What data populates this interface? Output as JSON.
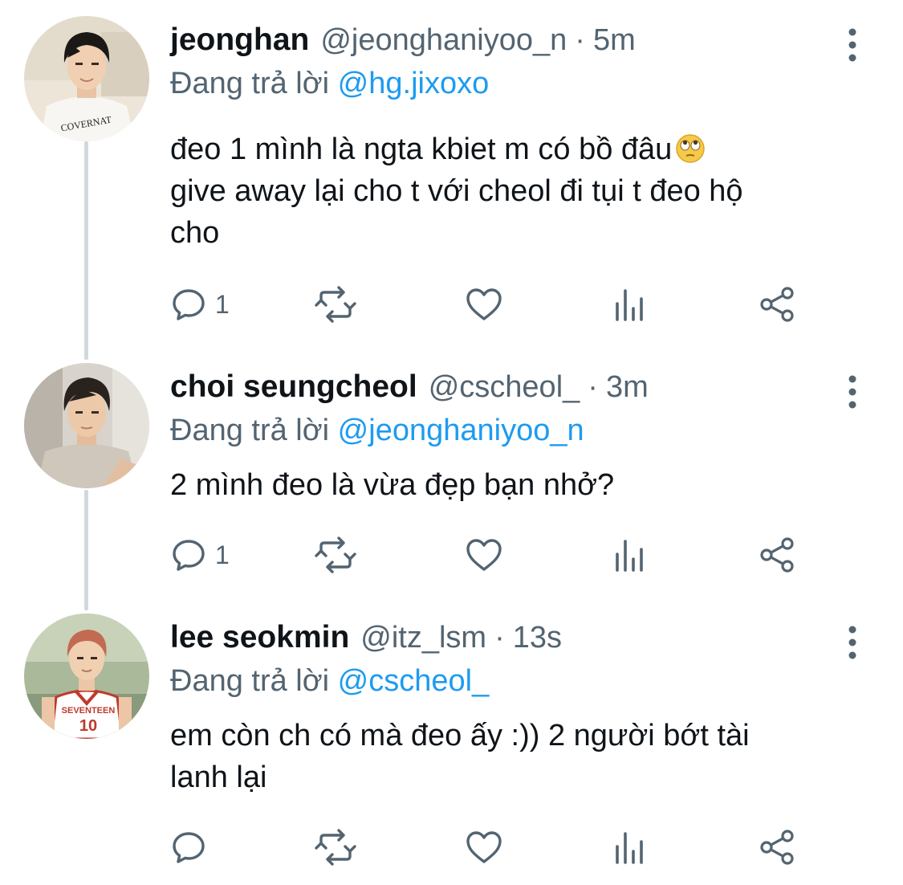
{
  "tweets": [
    {
      "name": "jeonghan",
      "handle": "@jeonghaniyoo_n",
      "separator": "·",
      "time": "5m",
      "reply_prefix": "Đang trả lời",
      "reply_to": "@hg.jixoxo",
      "text_lines": [
        "đeo 1 mình là ngta kbiet m có bồ đâu",
        "give away lại cho t với cheol đi tụi t đeo hộ",
        "cho"
      ],
      "emoji": "face-with-rolling-eyes",
      "reply_count": "1",
      "avatar_shirt_text": "COVERNAT"
    },
    {
      "name": "choi seungcheol",
      "handle": "@cscheol_",
      "separator": "·",
      "time": "3m",
      "reply_prefix": "Đang trả lời",
      "reply_to": "@jeonghaniyoo_n",
      "text_lines": [
        "2 mình đeo là vừa đẹp bạn nhở?"
      ],
      "reply_count": "1"
    },
    {
      "name": "lee seokmin",
      "handle": "@itz_lsm",
      "separator": "·",
      "time": "13s",
      "reply_prefix": "Đang trả lời",
      "reply_to": "@cscheol_",
      "text_lines": [
        "em còn ch có mà đeo ấy :)) 2 người bớt tài",
        "lanh lại"
      ],
      "reply_count": "",
      "avatar_jersey_text": "SEVENTEEN",
      "avatar_jersey_number": "10"
    }
  ],
  "icons": {
    "reply": "reply-icon",
    "retweet": "retweet-icon",
    "like": "like-icon",
    "views": "views-icon",
    "share": "share-icon",
    "more": "more-icon"
  },
  "colors": {
    "text": "#0f1419",
    "secondary": "#536471",
    "link": "#1d9bf0",
    "thread_line": "#cfd9de"
  }
}
